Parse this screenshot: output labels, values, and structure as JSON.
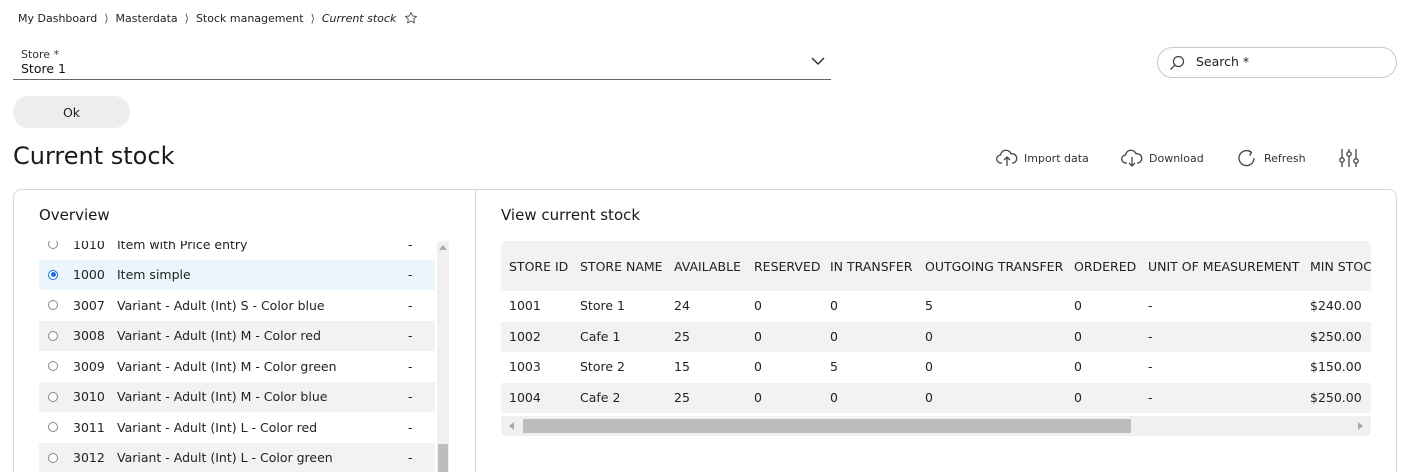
{
  "breadcrumb": {
    "items": [
      "My Dashboard",
      "Masterdata",
      "Stock management"
    ],
    "current": "Current stock",
    "separator": "⟩"
  },
  "store": {
    "label": "Store *",
    "value": "Store 1"
  },
  "search": {
    "label": "Search *"
  },
  "ok_label": "Ok",
  "page_title": "Current stock",
  "toolbar": {
    "import_label": "Import data",
    "download_label": "Download",
    "refresh_label": "Refresh"
  },
  "overview": {
    "title": "Overview",
    "items": [
      {
        "num": "1010",
        "name": "Item with Price entry",
        "dash": "-"
      },
      {
        "num": "1000",
        "name": "Item simple",
        "dash": "-"
      },
      {
        "num": "3007",
        "name": "Variant - Adult (Int) S - Color blue",
        "dash": "-"
      },
      {
        "num": "3008",
        "name": "Variant - Adult (Int) M - Color red",
        "dash": "-"
      },
      {
        "num": "3009",
        "name": "Variant - Adult (Int) M - Color green",
        "dash": "-"
      },
      {
        "num": "3010",
        "name": "Variant - Adult (Int) M - Color blue",
        "dash": "-"
      },
      {
        "num": "3011",
        "name": "Variant - Adult (Int) L - Color red",
        "dash": "-"
      },
      {
        "num": "3012",
        "name": "Variant - Adult (Int) L - Color green",
        "dash": "-"
      }
    ]
  },
  "stock": {
    "title": "View current stock",
    "columns": [
      "STORE ID",
      "STORE NAME",
      "AVAILABLE",
      "RESERVED",
      "IN TRANSFER",
      "OUTGOING TRANSFER",
      "ORDERED",
      "UNIT OF MEASUREMENT",
      "MIN STOC"
    ],
    "rows": [
      [
        "1001",
        "Store 1",
        "24",
        "0",
        "0",
        "5",
        "0",
        "-",
        "$240.00"
      ],
      [
        "1002",
        "Cafe 1",
        "25",
        "0",
        "0",
        "0",
        "0",
        "-",
        "$250.00"
      ],
      [
        "1003",
        "Store 2",
        "15",
        "0",
        "5",
        "0",
        "0",
        "-",
        "$150.00"
      ],
      [
        "1004",
        "Cafe 2",
        "25",
        "0",
        "0",
        "0",
        "0",
        "-",
        "$250.00"
      ]
    ]
  },
  "colors": {
    "accent": "#1b6ee0",
    "selected_row": "#eaf6fb",
    "stripe": "#f2f2f2"
  }
}
